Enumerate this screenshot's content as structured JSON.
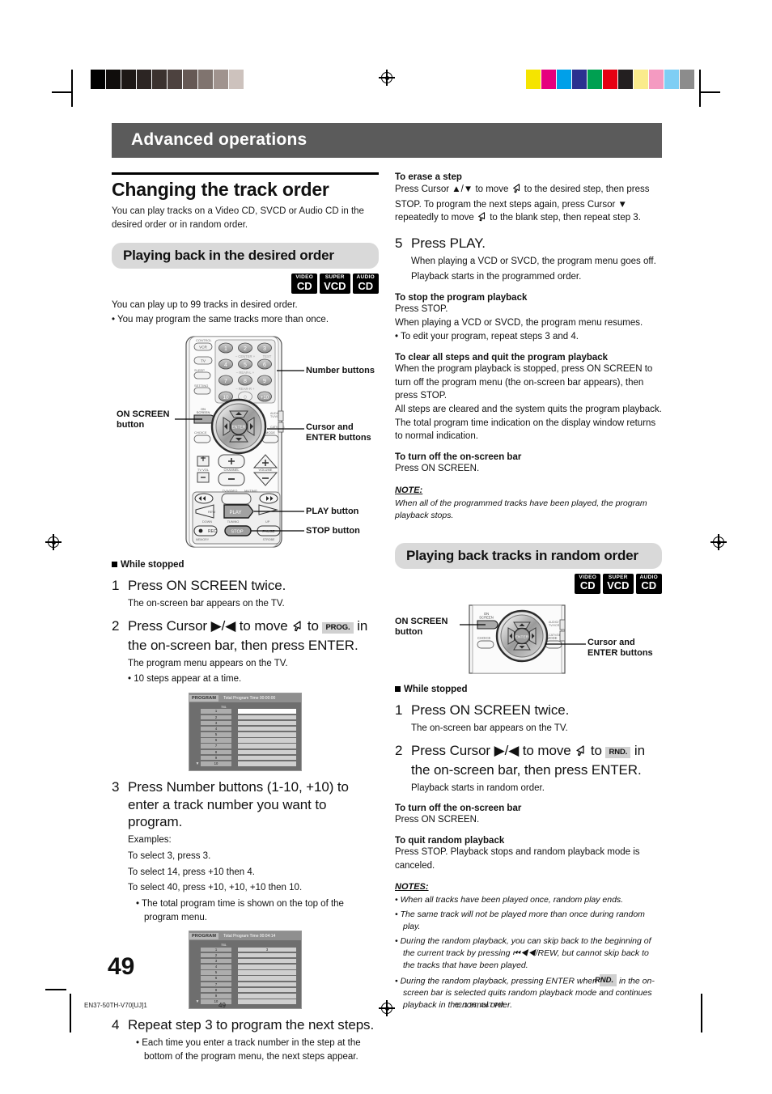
{
  "chapter": {
    "title": "Advanced operations"
  },
  "left": {
    "section_title": "Changing the track order",
    "lede": "You can play tracks on a Video CD, SVCD or Audio CD in the desired order or in random order.",
    "subhead": "Playing back in the desired order",
    "badges": [
      {
        "top": "VIDEO",
        "bottom": "CD"
      },
      {
        "top": "SUPER",
        "bottom": "VCD"
      },
      {
        "top": "AUDIO",
        "bottom": "CD"
      }
    ],
    "intro1": "You can play up to 99 tracks in desired order.",
    "intro2": "• You may program the same tracks more than once.",
    "callouts": {
      "number_buttons": "Number buttons",
      "on_screen": "ON SCREEN\nbutton",
      "on_screen_l1": "ON SCREEN",
      "on_screen_l2": "button",
      "cursor_enter_l1": "Cursor and",
      "cursor_enter_l2": "ENTER buttons",
      "play": "PLAY button",
      "stop": "STOP button"
    },
    "while_stopped": "While stopped",
    "step1": {
      "num": "1",
      "text": "Press ON SCREEN twice.",
      "sub": "The on-screen bar appears on the TV."
    },
    "step2": {
      "num": "2",
      "t1": "Press Cursor ▶/◀ to move",
      "t2": "to",
      "key": "PROG.",
      "t3": "in the on-screen bar, then press ENTER.",
      "sub1": "The program menu appears on the TV.",
      "sub2": "• 10 steps appear at a time."
    },
    "osd1": {
      "label": "PROGRAM",
      "total": "Total Program Time 00:00:00",
      "col_header": "No.",
      "rows": [
        "1",
        "2",
        "3",
        "4",
        "5",
        "6",
        "7",
        "8",
        "9",
        "10"
      ],
      "values": [
        "",
        "",
        "",
        "",
        "",
        "",
        "",
        "",
        "",
        ""
      ]
    },
    "step3": {
      "num": "3",
      "text": "Press Number buttons (1-10, +10) to enter a track number you want to program.",
      "sub": [
        "Examples:",
        "To select 3, press 3.",
        "To select 14, press +10 then 4.",
        "To select 40, press +10, +10, +10 then 10."
      ],
      "bullet": "• The total program time is shown on the top of the program menu."
    },
    "osd2": {
      "label": "PROGRAM",
      "total": "Total Program Time 00:04:14",
      "col_header": "No.",
      "rows": [
        "1",
        "2",
        "3",
        "4",
        "5",
        "6",
        "7",
        "8",
        "9",
        "10"
      ],
      "values": [
        "3",
        "",
        "",
        "",
        "",
        "",
        "",
        "",
        "",
        ""
      ]
    },
    "step4": {
      "num": "4",
      "text": "Repeat step 3 to program the next steps.",
      "bullet": "• Each time you enter a track number in the step at the bottom of the program menu, the next steps appear."
    }
  },
  "right": {
    "erase_head": "To erase a step",
    "erase_l1": "Press Cursor ▲/▼ to move",
    "erase_l2": "to the desired step, then press STOP.",
    "erase_l3": "To program the next steps again, press Cursor ▼ repeatedly to move",
    "erase_l4": "to the blank step, then repeat step 3.",
    "step5": {
      "num": "5",
      "text": "Press PLAY.",
      "sub1": "When playing a VCD or SVCD, the program menu goes off.",
      "sub2": "Playback starts in the programmed order."
    },
    "stop_head": "To stop the program playback",
    "stop_b1": "Press STOP.",
    "stop_b2": "When playing a VCD or SVCD, the program menu resumes.",
    "stop_b3": "• To edit your program, repeat steps 3 and 4.",
    "clear_head": "To clear all steps and quit the program playback",
    "clear_b1": "When the program playback is stopped, press ON SCREEN to turn off the program menu (the on-screen bar appears), then press STOP.",
    "clear_b2": "All steps are cleared and the system quits the program playback.",
    "clear_b3": "The total program time indication on the display window returns to normal indication.",
    "osb_head": "To turn off the on-screen bar",
    "osb_b1": "Press ON SCREEN.",
    "note_head": "NOTE:",
    "note_body": "When all of the programmed tracks have been played, the program playback stops.",
    "subhead": "Playing back tracks in random order",
    "badges": [
      {
        "top": "VIDEO",
        "bottom": "CD"
      },
      {
        "top": "SUPER",
        "bottom": "VCD"
      },
      {
        "top": "AUDIO",
        "bottom": "CD"
      }
    ],
    "callouts": {
      "on_screen_l1": "ON SCREEN",
      "on_screen_l2": "button",
      "cursor_enter_l1": "Cursor and",
      "cursor_enter_l2": "ENTER buttons"
    },
    "while_stopped": "While stopped",
    "step1": {
      "num": "1",
      "text": "Press ON SCREEN twice.",
      "sub": "The on-screen bar appears on the TV."
    },
    "step2": {
      "num": "2",
      "t1": "Press Cursor ▶/◀ to move",
      "t2": "to",
      "key": "RND.",
      "t3": "in the on-screen bar, then press ENTER.",
      "sub1": "Playback starts in random order."
    },
    "osb2_head": "To turn off the on-screen bar",
    "osb2_b1": "Press ON SCREEN.",
    "quit_head": "To quit random playback",
    "quit_b1": "Press STOP. Playback stops and random playback mode is canceled.",
    "notes_head": "NOTES:",
    "notes": [
      "•  When all tracks have been played once, random play ends.",
      "•  The same track will not be played more than once during random play.",
      "•  During the random playback, you can skip back to the beginning of the current track by pressing ⏮◀◀/REW, but cannot skip back to the tracks that have been played."
    ],
    "note_last_a": "•  During the random playback, pressing ENTER when",
    "note_last_key": "RND.",
    "note_last_b": "in the on-screen bar is selected quits random playback mode and continues playback in the normal order."
  },
  "page_number": "49",
  "footer": {
    "file": "EN37-50TH-V70[UJ]1",
    "page": "49",
    "timestamp": "02.3.26, 4:47 PM"
  },
  "colors": {
    "band": "#5b5b5b",
    "subhead_bg": "#d9d9d9",
    "key_bg": "#d0d0d0",
    "gray_swatches": [
      "#000000",
      "#100d0c",
      "#1d1816",
      "#2c2523",
      "#3b322f",
      "#4d423f",
      "#665955",
      "#80746f",
      "#a0938e",
      "#cdc2bd",
      "#ffffff"
    ],
    "color_swatches": [
      "#f5e400",
      "#e6007e",
      "#00a0e9",
      "#2b3190",
      "#00a051",
      "#e60012",
      "#231f20",
      "#faeb8c",
      "#f49ac1",
      "#7ecef4",
      "#8c8c8c"
    ]
  }
}
